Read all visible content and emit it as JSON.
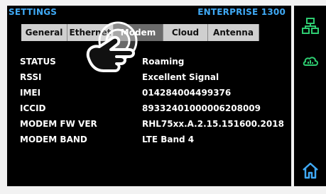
{
  "header": {
    "title": "SETTINGS",
    "device": "ENTERPRISE 1300"
  },
  "tabs": [
    {
      "label": "General"
    },
    {
      "label": "Ethernet"
    },
    {
      "label": "Modem"
    },
    {
      "label": "Cloud"
    },
    {
      "label": "Antenna"
    }
  ],
  "modem": {
    "rows": [
      {
        "label": "STATUS",
        "value": "Roaming"
      },
      {
        "label": "RSSI",
        "value": "Excellent Signal"
      },
      {
        "label": "IMEI",
        "value": "014284004499376"
      },
      {
        "label": "ICCID",
        "value": "89332401000006208009"
      },
      {
        "label": "MODEM FW VER",
        "value": "RHL75xx.A.2.15.151600.2018"
      },
      {
        "label": "MODEM BAND",
        "value": "LTE Band 4"
      }
    ]
  },
  "sidebar": {
    "icons": [
      {
        "name": "network-icon"
      },
      {
        "name": "cloud-icon"
      },
      {
        "name": "home-icon"
      }
    ]
  },
  "colors": {
    "accent": "#3fa9f5",
    "green": "#2ecc71",
    "tab_bg": "#cfcfcf",
    "tab_active_bg": "#6b6b6b"
  }
}
